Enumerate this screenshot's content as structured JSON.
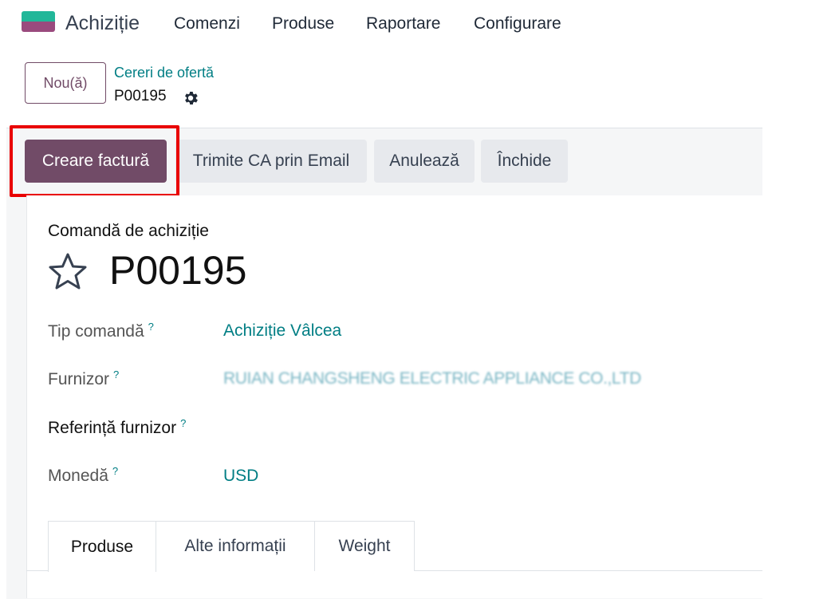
{
  "app": {
    "name": "Achiziție",
    "menu": [
      "Comenzi",
      "Produse",
      "Raportare",
      "Configurare"
    ]
  },
  "control_panel": {
    "new_button": "Nou(ă)",
    "breadcrumb_parent": "Cereri de ofertă",
    "breadcrumb_current": "P00195"
  },
  "status_bar": {
    "buttons": [
      "Creare factură",
      "Trimite CA prin Email",
      "Anulează",
      "Închide"
    ],
    "highlighted": "Creare factură"
  },
  "form": {
    "doc_type": "Comandă de achiziție",
    "doc_name": "P00195",
    "fields": [
      {
        "label": "Tip comandă",
        "help": "?",
        "value": "Achiziție Vâlcea"
      },
      {
        "label": "Furnizor",
        "help": "?",
        "value": "RUIAN CHANGSHENG ELECTRIC APPLIANCE CO.,LTD"
      },
      {
        "label": "Referință furnizor",
        "help": "?",
        "value": ""
      },
      {
        "label": "Monedă",
        "help": "?",
        "value": "USD"
      }
    ],
    "tabs": [
      "Produse",
      "Alte informații",
      "Weight"
    ],
    "active_tab": "Produse"
  },
  "colors": {
    "brand": "#714b67",
    "link": "#017e84",
    "highlight": "#e90000"
  },
  "icons": [
    "app-logo-icon",
    "gear-icon",
    "star-icon"
  ]
}
